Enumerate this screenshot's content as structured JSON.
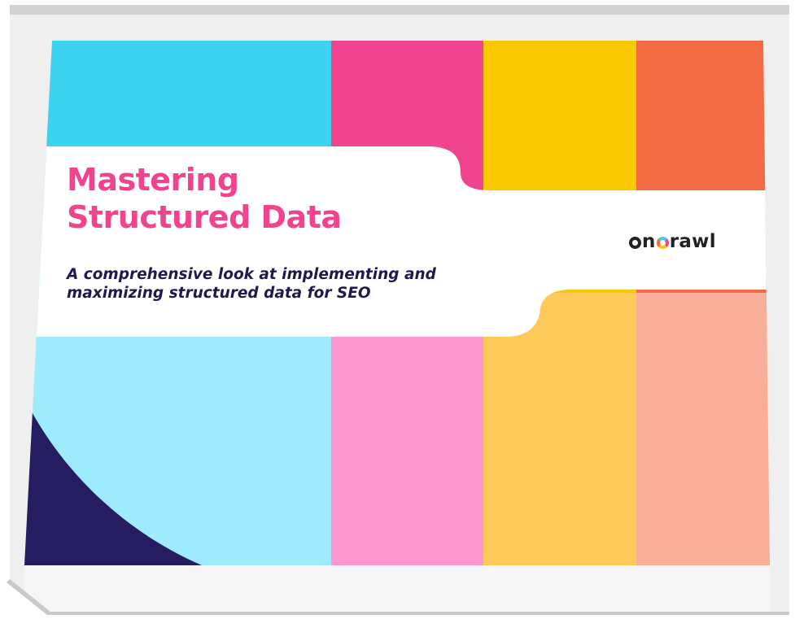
{
  "cover": {
    "title_lines": [
      "Mastering",
      "Structured Data"
    ],
    "subtitle_lines": [
      "A comprehensive look at implementing and",
      "maximizing structured data for SEO"
    ],
    "brand": {
      "prefix": "o",
      "letter_n": "n",
      "letter_c": "c",
      "suffix": "rawl"
    }
  },
  "colors": {
    "title": "#f2438f",
    "subtitle": "#1f1a4e",
    "brand_text": "#222222",
    "cyan": "#3dd2f0",
    "cyan_light": "#9eebfc",
    "pink": "#f0448f",
    "pink_light": "#fc98cf",
    "yellow": "#f8c800",
    "yellow_light": "#fdca5a",
    "orange": "#f26b42",
    "orange_light": "#f9ae99",
    "navy": "#261c62",
    "box_side": "#efefef",
    "box_edge": "#c9c9c9"
  }
}
